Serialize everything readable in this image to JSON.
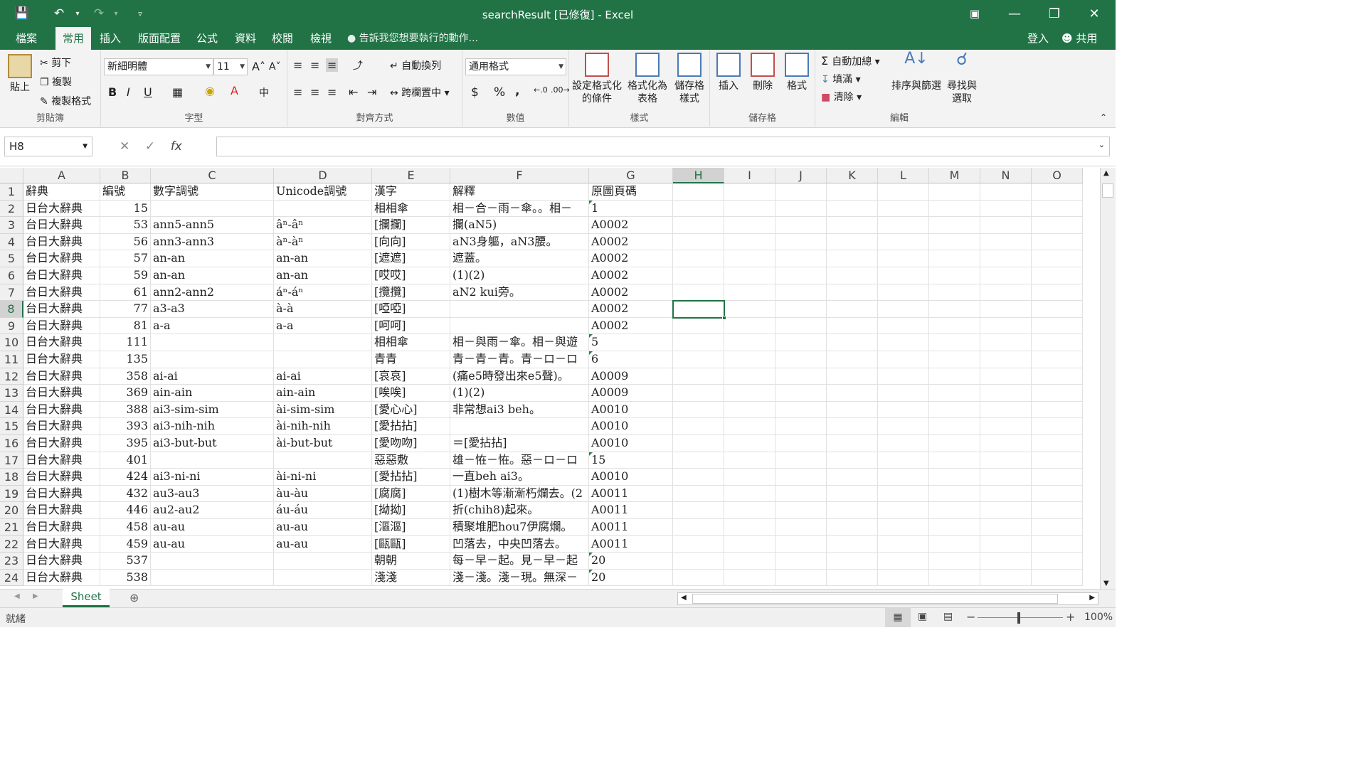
{
  "window": {
    "title": "searchResult [已修復] - Excel"
  },
  "tabs": [
    "檔案",
    "常用",
    "插入",
    "版面配置",
    "公式",
    "資料",
    "校閱",
    "檢視"
  ],
  "tell_me": "告訴我您想要執行的動作...",
  "account": {
    "signin": "登入",
    "share": "共用"
  },
  "ribbon": {
    "clipboard": {
      "label": "剪貼簿",
      "paste": "貼上",
      "cut": "剪下",
      "copy": "複製",
      "format_painter": "複製格式"
    },
    "font": {
      "label": "字型",
      "name": "新細明體",
      "size": "11",
      "bold": "B",
      "italic": "I",
      "underline": "U"
    },
    "alignment": {
      "label": "對齊方式",
      "wrap": "自動換列",
      "merge": "跨欄置中"
    },
    "number": {
      "label": "數值",
      "format": "通用格式",
      "currency": "$",
      "percent": "%",
      "comma": ","
    },
    "styles": {
      "label": "樣式",
      "conditional": "設定格式化的條件",
      "table": "格式化為表格",
      "cell_styles": "儲存格樣式"
    },
    "cells": {
      "label": "儲存格",
      "insert": "插入",
      "delete": "刪除",
      "format": "格式"
    },
    "editing": {
      "label": "編輯",
      "autosum": "自動加總",
      "fill": "填滿",
      "clear": "清除",
      "sort": "排序與篩選",
      "find": "尋找與選取"
    }
  },
  "formula_bar": {
    "name_box": "H8",
    "formula": ""
  },
  "columns": [
    "A",
    "B",
    "C",
    "D",
    "E",
    "F",
    "G",
    "H",
    "I",
    "J",
    "K",
    "L",
    "M",
    "N",
    "O"
  ],
  "selected_cell": {
    "col": "H",
    "row": 8
  },
  "rows": [
    [
      "辭典",
      "編號",
      "數字調號",
      "Unicode調號",
      "漢字",
      "解釋",
      "原圖頁碼"
    ],
    [
      "日台大辭典",
      "15",
      "",
      "",
      "相相傘",
      "相－合－雨－傘。。相－",
      "1"
    ],
    [
      "台日大辭典",
      "53",
      "ann5-ann5",
      "âⁿ-âⁿ",
      "[攔攔]",
      "攔(aN5)",
      "A0002"
    ],
    [
      "台日大辭典",
      "56",
      "ann3-ann3",
      "àⁿ-àⁿ",
      "[向向]",
      "aN3身軀，aN3腰。",
      "A0002"
    ],
    [
      "台日大辭典",
      "57",
      "an-an",
      "an-an",
      "[遮遮]",
      "遮蓋。",
      "A0002"
    ],
    [
      "台日大辭典",
      "59",
      "an-an",
      "an-an",
      "[哎哎]",
      "(1)(2)",
      "A0002"
    ],
    [
      "台日大辭典",
      "61",
      "ann2-ann2",
      "áⁿ-áⁿ",
      "[攬攬]",
      "aN2 kui旁。",
      "A0002"
    ],
    [
      "台日大辭典",
      "77",
      "a3-a3",
      "à-à",
      "[啞啞]",
      "",
      "A0002"
    ],
    [
      "台日大辭典",
      "81",
      "a-a",
      "a-a",
      "[呵呵]",
      "",
      "A0002"
    ],
    [
      "日台大辭典",
      "111",
      "",
      "",
      "相相傘",
      "相－與雨－傘。相－與遊",
      "5"
    ],
    [
      "日台大辭典",
      "135",
      "",
      "",
      "青青",
      "青－青－青。青－ロ－ロ",
      "6"
    ],
    [
      "台日大辭典",
      "358",
      "ai-ai",
      "ai-ai",
      "[哀哀]",
      "(痛e5時發出來e5聲)。",
      "A0009"
    ],
    [
      "台日大辭典",
      "369",
      "ain-ain",
      "ain-ain",
      "[唉唉]",
      "(1)(2)",
      "A0009"
    ],
    [
      "台日大辭典",
      "388",
      "ai3-sim-sim",
      "ài-sim-sim",
      "[愛心心]",
      "非常想ai3 beh。",
      "A0010"
    ],
    [
      "台日大辭典",
      "393",
      "ai3-nih-nih",
      "ài-nih-nih",
      "[愛拈拈]",
      "",
      "A0010"
    ],
    [
      "台日大辭典",
      "395",
      "ai3-but-but",
      "ài-but-but",
      "[愛吻吻]",
      "＝[愛拈拈]",
      "A0010"
    ],
    [
      "日台大辭典",
      "401",
      "",
      "",
      "惡惡敷",
      "雄－恠－恠。惡－ロ－ロ",
      "15"
    ],
    [
      "台日大辭典",
      "424",
      "ai3-ni-ni",
      "ài-ni-ni",
      "[愛拈拈]",
      "一直beh ai3。",
      "A0010"
    ],
    [
      "台日大辭典",
      "432",
      "au3-au3",
      "àu-àu",
      "[腐腐]",
      "(1)樹木等漸漸朽爛去。(2",
      "A0011"
    ],
    [
      "台日大辭典",
      "446",
      "au2-au2",
      "áu-áu",
      "[拗拗]",
      "折(chih8)起來。",
      "A0011"
    ],
    [
      "台日大辭典",
      "458",
      "au-au",
      "au-au",
      "[漚漚]",
      "積聚堆肥hou7伊腐爛。",
      "A0011"
    ],
    [
      "台日大辭典",
      "459",
      "au-au",
      "au-au",
      "[甌甌]",
      "凹落去，中央凹落去。",
      "A0011"
    ],
    [
      "日台大辭典",
      "537",
      "",
      "",
      "朝朝",
      "每－早－起。見－早－起",
      "20"
    ],
    [
      "日台大辭典",
      "538",
      "",
      "",
      "淺淺",
      "淺－淺。淺－現。無深－",
      "20"
    ]
  ],
  "sheet_tab": "Sheet",
  "status": {
    "ready": "就緒",
    "zoom": "100%"
  }
}
